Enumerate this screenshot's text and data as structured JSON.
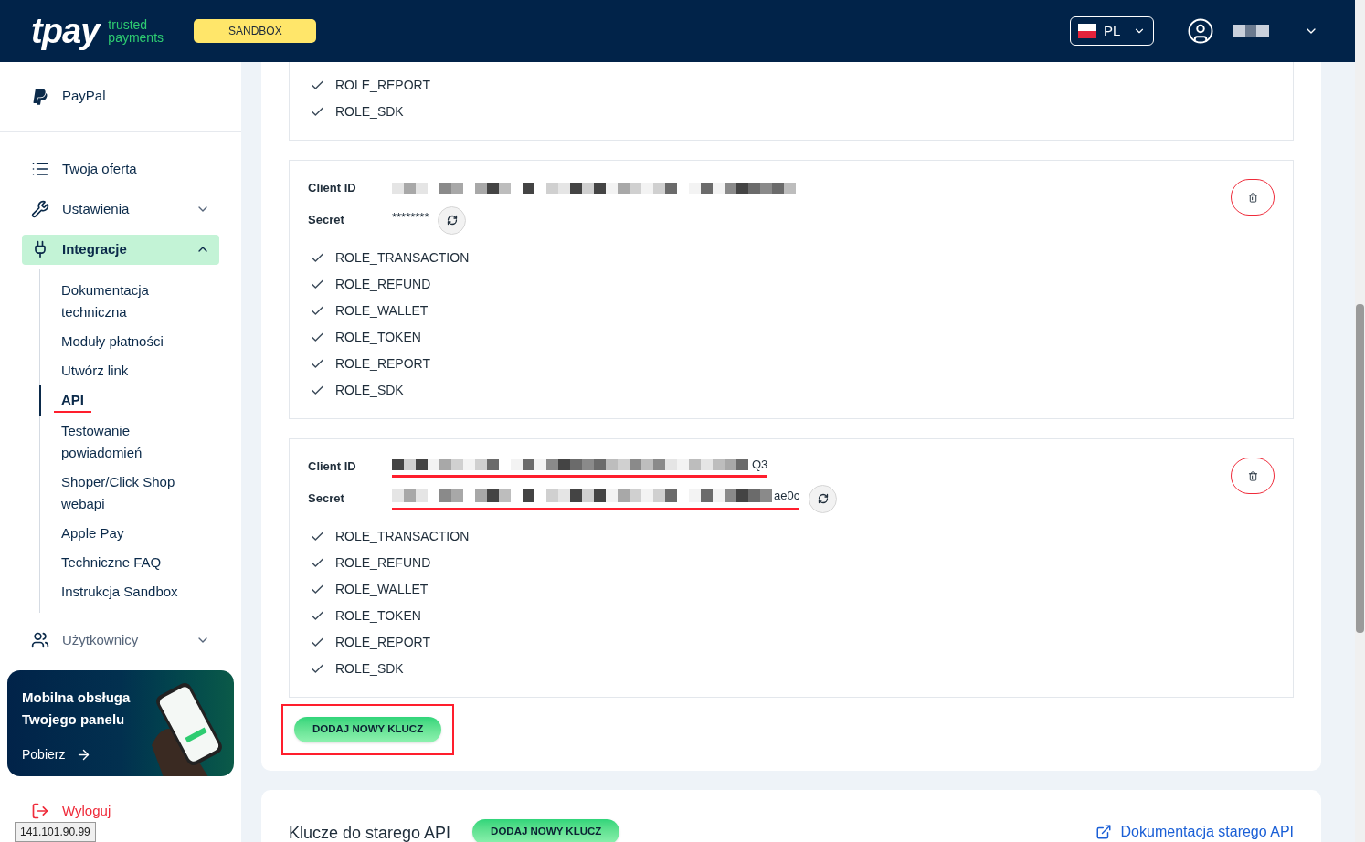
{
  "header": {
    "logo": "tpay",
    "tagline": "trusted payments",
    "env_badge": "SANDBOX",
    "language": "PL"
  },
  "sidebar": {
    "top_item": {
      "label": "PayPal"
    },
    "items": [
      {
        "label": "Twoja oferta",
        "kind": "list",
        "selected": false,
        "has_children": false
      },
      {
        "label": "Ustawienia",
        "kind": "wrench",
        "selected": false,
        "expanded": false,
        "has_children": true
      },
      {
        "label": "Integracje",
        "kind": "plug",
        "selected": true,
        "expanded": true,
        "has_children": true,
        "children": [
          {
            "label": "Dokumentacja techniczna",
            "selected": false,
            "underlined": false
          },
          {
            "label": "Moduły płatności",
            "selected": false,
            "underlined": false
          },
          {
            "label": "Utwórz link",
            "selected": false,
            "underlined": false
          },
          {
            "label": "API",
            "selected": true,
            "underlined": true
          },
          {
            "label": "Testowanie powiadomień",
            "selected": false,
            "underlined": false
          },
          {
            "label": "Shoper/Click Shop webapi",
            "selected": false,
            "underlined": false
          },
          {
            "label": "Apple Pay",
            "selected": false,
            "underlined": false
          },
          {
            "label": "Techniczne FAQ",
            "selected": false,
            "underlined": false
          },
          {
            "label": "Instrukcja Sandbox",
            "selected": false,
            "underlined": false
          }
        ]
      },
      {
        "label": "Użytkownicy",
        "kind": "users",
        "selected": false,
        "expanded": false,
        "has_children": true
      }
    ],
    "promo": {
      "title": "Mobilna obsługa Twojego panelu",
      "link": "Pobierz"
    },
    "logout": "Wyloguj",
    "ip_tooltip": "141.101.90.99"
  },
  "partial_key": {
    "roles": [
      "ROLE_REPORT",
      "ROLE_SDK"
    ]
  },
  "keys": [
    {
      "client_id_label": "Client ID",
      "secret_label": "Secret",
      "secret": "********",
      "secret_masked": true,
      "underlined": false,
      "roles": [
        "ROLE_TRANSACTION",
        "ROLE_REFUND",
        "ROLE_WALLET",
        "ROLE_TOKEN",
        "ROLE_REPORT",
        "ROLE_SDK"
      ]
    },
    {
      "client_id_label": "Client ID",
      "client_id_tail": "Q3",
      "secret_label": "Secret",
      "secret": "ae0c",
      "secret_masked": false,
      "underlined": true,
      "roles": [
        "ROLE_TRANSACTION",
        "ROLE_REFUND",
        "ROLE_WALLET",
        "ROLE_TOKEN",
        "ROLE_REPORT",
        "ROLE_SDK"
      ]
    }
  ],
  "add_key_button": {
    "label": "DODAJ NOWY KLUCZ",
    "highlighted": true
  },
  "old_api": {
    "title": "Klucze do starego API",
    "button": "DODAJ NOWY KLUCZ",
    "doc_link": "Dokumentacja starego API"
  }
}
